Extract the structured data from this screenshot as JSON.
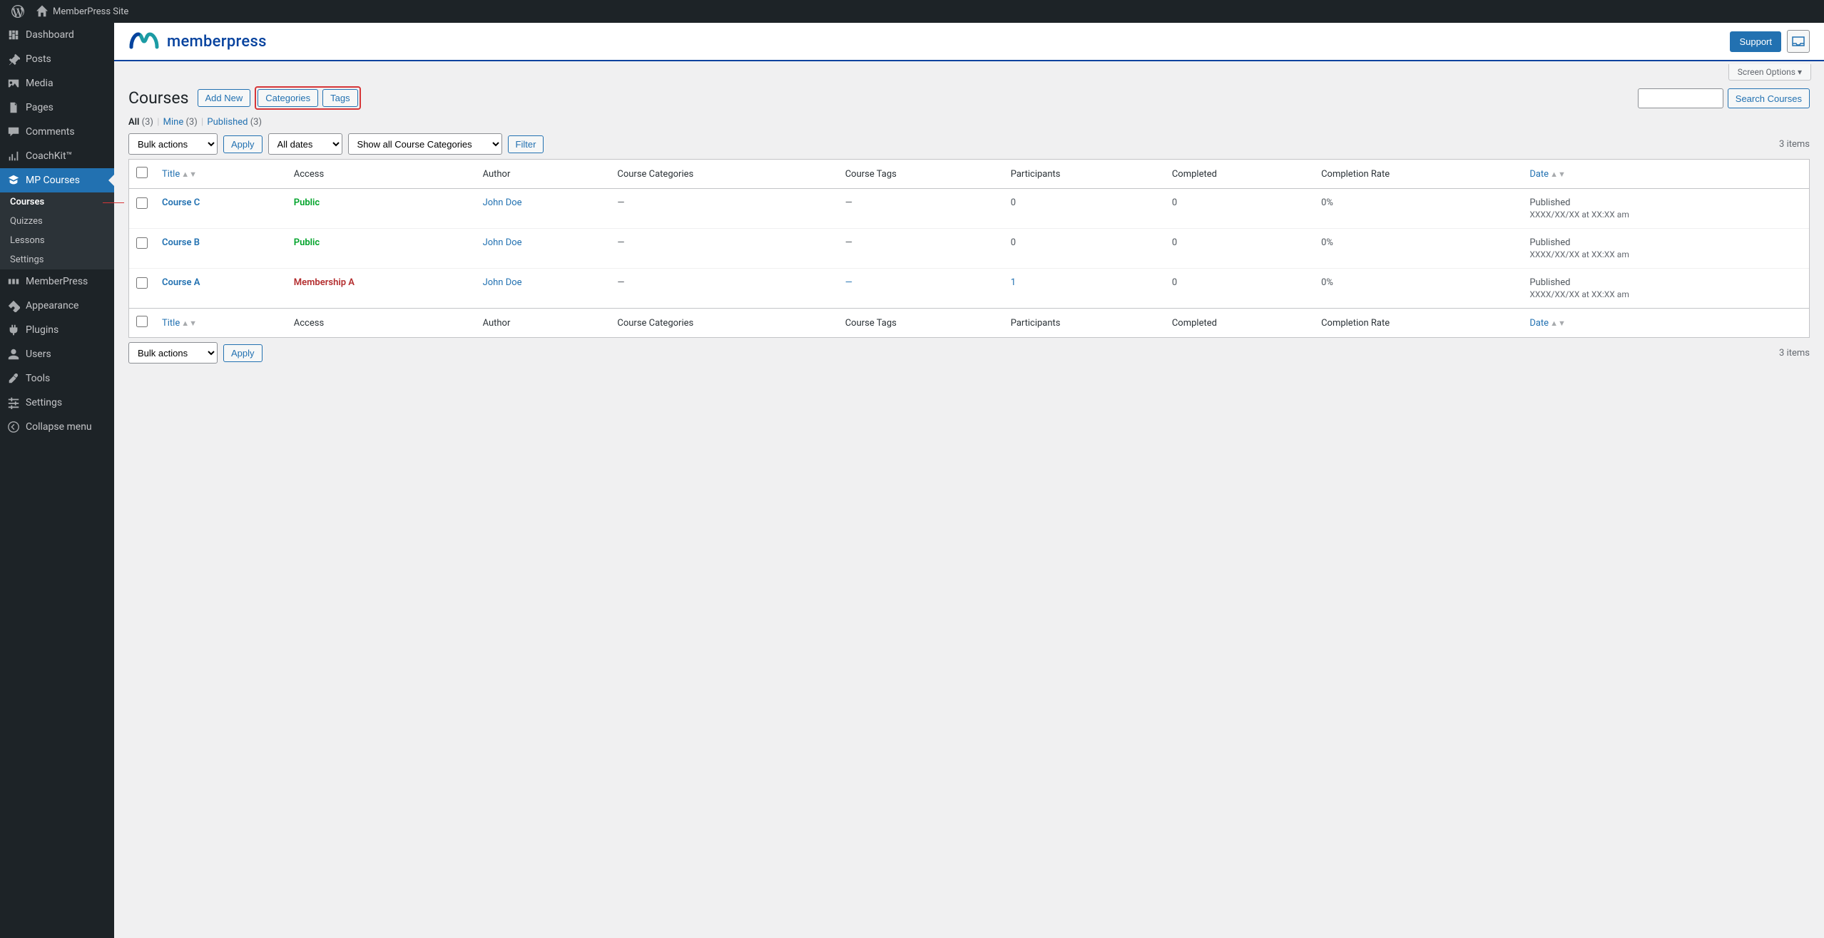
{
  "adminBar": {
    "site": "MemberPress Site"
  },
  "sidebar": {
    "items": [
      {
        "label": "Dashboard"
      },
      {
        "label": "Posts"
      },
      {
        "label": "Media"
      },
      {
        "label": "Pages"
      },
      {
        "label": "Comments"
      },
      {
        "label": "CoachKit™"
      },
      {
        "label": "MP Courses"
      },
      {
        "label": "MemberPress"
      },
      {
        "label": "Appearance"
      },
      {
        "label": "Plugins"
      },
      {
        "label": "Users"
      },
      {
        "label": "Tools"
      },
      {
        "label": "Settings"
      },
      {
        "label": "Collapse menu"
      }
    ],
    "submenu": [
      {
        "label": "Courses"
      },
      {
        "label": "Quizzes"
      },
      {
        "label": "Lessons"
      },
      {
        "label": "Settings"
      }
    ]
  },
  "header": {
    "brand": "memberpress",
    "support": "Support"
  },
  "screenOptions": "Screen Options ▾",
  "page": {
    "title": "Courses",
    "addNew": "Add New",
    "categories": "Categories",
    "tags": "Tags"
  },
  "search": {
    "button": "Search Courses"
  },
  "views": {
    "all": "All",
    "allCount": "(3)",
    "mine": "Mine",
    "mineCount": "(3)",
    "published": "Published",
    "publishedCount": "(3)"
  },
  "bulk": {
    "label": "Bulk actions",
    "apply": "Apply",
    "allDates": "All dates",
    "showAll": "Show all Course Categories",
    "filter": "Filter",
    "itemsCount": "3 items"
  },
  "columns": {
    "title": "Title",
    "access": "Access",
    "author": "Author",
    "categories": "Course Categories",
    "tags": "Course Tags",
    "participants": "Participants",
    "completed": "Completed",
    "completionRate": "Completion Rate",
    "date": "Date"
  },
  "rows": [
    {
      "title": "Course C",
      "access": "Public",
      "accessClass": "acc-public",
      "author": "John Doe",
      "categories": "—",
      "tags": "—",
      "participants": "0",
      "completed": "0",
      "rate": "0%",
      "status": "Published",
      "date": "XXXX/XX/XX at XX:XX am",
      "tagsLink": false,
      "partLink": false
    },
    {
      "title": "Course B",
      "access": "Public",
      "accessClass": "acc-public",
      "author": "John Doe",
      "categories": "—",
      "tags": "—",
      "participants": "0",
      "completed": "0",
      "rate": "0%",
      "status": "Published",
      "date": "XXXX/XX/XX at XX:XX am",
      "tagsLink": false,
      "partLink": false
    },
    {
      "title": "Course A",
      "access": "Membership A",
      "accessClass": "acc-member",
      "author": "John Doe",
      "categories": "—",
      "tags": "—",
      "participants": "1",
      "completed": "0",
      "rate": "0%",
      "status": "Published",
      "date": "XXXX/XX/XX at XX:XX am",
      "tagsLink": true,
      "partLink": true
    }
  ]
}
